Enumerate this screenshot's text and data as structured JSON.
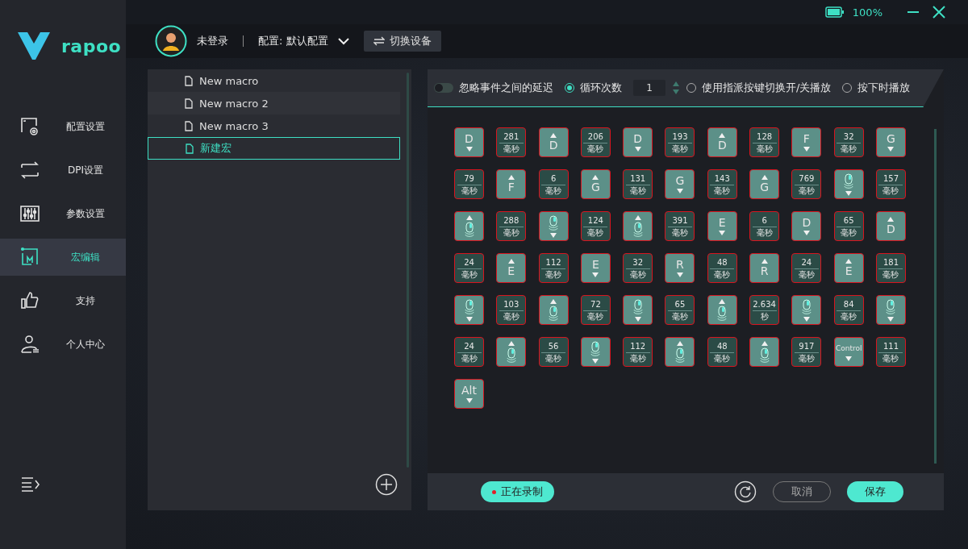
{
  "brand": {
    "name": "rapoo"
  },
  "sidebar": {
    "items": [
      {
        "label": "配置设置",
        "selected": false
      },
      {
        "label": "DPI设置",
        "selected": false
      },
      {
        "label": "参数设置",
        "selected": false
      },
      {
        "label": "宏编辑",
        "selected": true
      },
      {
        "label": "支持",
        "selected": false
      },
      {
        "label": "个人中心",
        "selected": false
      }
    ]
  },
  "status": {
    "battery": "100%"
  },
  "header": {
    "user": "未登录",
    "profile": "配置: 默认配置",
    "switch_button": "切换设备"
  },
  "macros": [
    {
      "name": "New macro",
      "selected": false
    },
    {
      "name": "New macro 2",
      "selected": false
    },
    {
      "name": "New macro 3",
      "selected": false
    },
    {
      "name": "新建宏",
      "selected": true
    }
  ],
  "options": [
    {
      "kind": "toggle",
      "label": "忽略事件之间的延迟",
      "on": false
    },
    {
      "kind": "radio",
      "label": "循环次数",
      "selected": true
    },
    {
      "kind": "count",
      "value": "1"
    },
    {
      "kind": "radio",
      "label": "使用指派按键切换开/关播放",
      "selected": false
    },
    {
      "kind": "radio",
      "label": "按下时播放",
      "selected": false
    }
  ],
  "events": [
    {
      "kind": "key_down",
      "label": "D"
    },
    {
      "kind": "delay",
      "value": "281",
      "unit": "毫秒"
    },
    {
      "kind": "key_up",
      "label": "D"
    },
    {
      "kind": "delay",
      "value": "206",
      "unit": "毫秒"
    },
    {
      "kind": "key_down",
      "label": "D"
    },
    {
      "kind": "delay",
      "value": "193",
      "unit": "毫秒"
    },
    {
      "kind": "key_up",
      "label": "D"
    },
    {
      "kind": "delay",
      "value": "128",
      "unit": "毫秒"
    },
    {
      "kind": "key_down",
      "label": "F"
    },
    {
      "kind": "delay",
      "value": "32",
      "unit": "毫秒"
    },
    {
      "kind": "key_down",
      "label": "G"
    },
    {
      "kind": "delay",
      "value": "79",
      "unit": "毫秒"
    },
    {
      "kind": "key_up",
      "label": "F"
    },
    {
      "kind": "delay",
      "value": "6",
      "unit": "毫秒"
    },
    {
      "kind": "key_up",
      "label": "G"
    },
    {
      "kind": "delay",
      "value": "131",
      "unit": "毫秒"
    },
    {
      "kind": "key_down",
      "label": "G"
    },
    {
      "kind": "delay",
      "value": "143",
      "unit": "毫秒"
    },
    {
      "kind": "key_up",
      "label": "G"
    },
    {
      "kind": "delay",
      "value": "769",
      "unit": "毫秒"
    },
    {
      "kind": "mouse_down"
    },
    {
      "kind": "delay",
      "value": "157",
      "unit": "毫秒"
    },
    {
      "kind": "mouse_up"
    },
    {
      "kind": "delay",
      "value": "288",
      "unit": "毫秒"
    },
    {
      "kind": "mouse_down"
    },
    {
      "kind": "delay",
      "value": "124",
      "unit": "毫秒"
    },
    {
      "kind": "mouse_up"
    },
    {
      "kind": "delay",
      "value": "391",
      "unit": "毫秒"
    },
    {
      "kind": "key_down",
      "label": "E"
    },
    {
      "kind": "delay",
      "value": "6",
      "unit": "毫秒"
    },
    {
      "kind": "key_down",
      "label": "D"
    },
    {
      "kind": "delay",
      "value": "65",
      "unit": "毫秒"
    },
    {
      "kind": "key_up",
      "label": "D"
    },
    {
      "kind": "delay",
      "value": "24",
      "unit": "毫秒"
    },
    {
      "kind": "key_up",
      "label": "E"
    },
    {
      "kind": "delay",
      "value": "112",
      "unit": "毫秒"
    },
    {
      "kind": "key_down",
      "label": "E"
    },
    {
      "kind": "delay",
      "value": "32",
      "unit": "毫秒"
    },
    {
      "kind": "key_down",
      "label": "R"
    },
    {
      "kind": "delay",
      "value": "48",
      "unit": "毫秒"
    },
    {
      "kind": "key_up",
      "label": "R"
    },
    {
      "kind": "delay",
      "value": "24",
      "unit": "毫秒"
    },
    {
      "kind": "key_up",
      "label": "E"
    },
    {
      "kind": "delay",
      "value": "181",
      "unit": "毫秒"
    },
    {
      "kind": "mouse_down"
    },
    {
      "kind": "delay",
      "value": "103",
      "unit": "毫秒"
    },
    {
      "kind": "mouse_up"
    },
    {
      "kind": "delay",
      "value": "72",
      "unit": "毫秒"
    },
    {
      "kind": "mouse_down"
    },
    {
      "kind": "delay",
      "value": "65",
      "unit": "毫秒"
    },
    {
      "kind": "mouse_up"
    },
    {
      "kind": "delay",
      "value": "2.634",
      "unit": "秒"
    },
    {
      "kind": "mouse_down"
    },
    {
      "kind": "delay",
      "value": "84",
      "unit": "毫秒"
    },
    {
      "kind": "mouse_down"
    },
    {
      "kind": "delay",
      "value": "24",
      "unit": "毫秒"
    },
    {
      "kind": "mouse_up"
    },
    {
      "kind": "delay",
      "value": "56",
      "unit": "毫秒"
    },
    {
      "kind": "mouse_down"
    },
    {
      "kind": "delay",
      "value": "112",
      "unit": "毫秒"
    },
    {
      "kind": "mouse_up"
    },
    {
      "kind": "delay",
      "value": "48",
      "unit": "毫秒"
    },
    {
      "kind": "mouse_up"
    },
    {
      "kind": "delay",
      "value": "917",
      "unit": "毫秒"
    },
    {
      "kind": "key_down",
      "label": "Control"
    },
    {
      "kind": "delay",
      "value": "111",
      "unit": "毫秒"
    },
    {
      "kind": "key_down",
      "label": "Alt"
    }
  ],
  "footer": {
    "record_button": "正在录制",
    "recording": true,
    "cancel_button": "取消",
    "save_button": "保存"
  }
}
